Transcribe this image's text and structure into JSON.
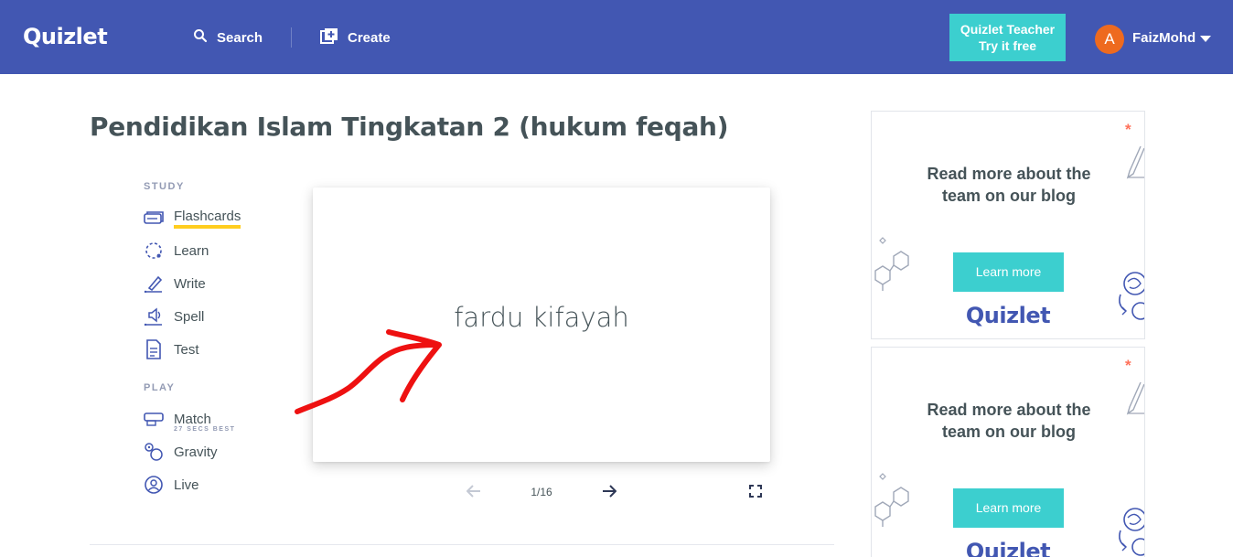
{
  "header": {
    "logo": "Quizlet",
    "search_label": "Search",
    "create_label": "Create",
    "teacher_line1": "Quizlet Teacher",
    "teacher_line2": "Try it free",
    "avatar_letter": "A",
    "username": "FaizMohd",
    "bg_color": "#4257b2"
  },
  "title": "Pendidikan Islam Tingkatan 2 (hukum feqah)",
  "sidebar": {
    "study_label": "STUDY",
    "play_label": "PLAY",
    "study_items": [
      {
        "label": "Flashcards",
        "icon": "flashcards-icon",
        "active": true
      },
      {
        "label": "Learn",
        "icon": "learn-icon"
      },
      {
        "label": "Write",
        "icon": "write-icon"
      },
      {
        "label": "Spell",
        "icon": "spell-icon"
      },
      {
        "label": "Test",
        "icon": "test-icon"
      }
    ],
    "play_items": [
      {
        "label": "Match",
        "icon": "match-icon",
        "sub": "27 SECS BEST"
      },
      {
        "label": "Gravity",
        "icon": "gravity-icon"
      },
      {
        "label": "Live",
        "icon": "live-icon"
      }
    ]
  },
  "card": {
    "term": "fardu kifayah",
    "counter": "1/16"
  },
  "ads": [
    {
      "text_line1": "Read more about the",
      "text_line2": "team on our blog",
      "button": "Learn more",
      "logo": "Quizlet"
    },
    {
      "text_line1": "Read more about the",
      "text_line2": "team on our blog",
      "button": "Learn more",
      "logo": "Quizlet"
    }
  ],
  "colors": {
    "accent": "#3ccfcf",
    "brand": "#4257b2",
    "underline": "#ffcd1f",
    "annotation": "#ee1111"
  }
}
